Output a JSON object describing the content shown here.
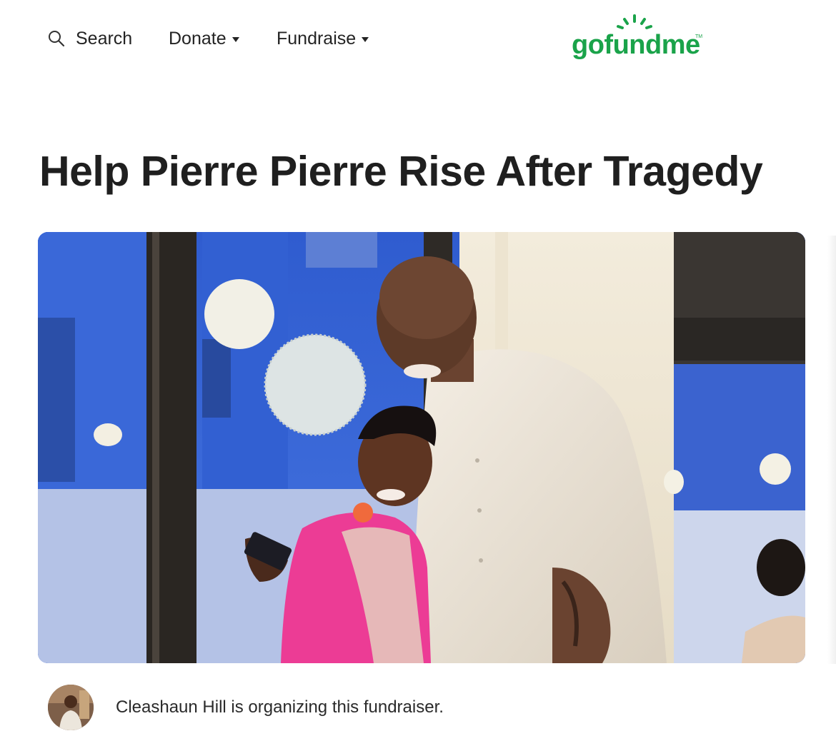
{
  "nav": {
    "search_label": "Search",
    "donate_label": "Donate",
    "fundraise_label": "Fundraise"
  },
  "brand": {
    "logo_text": "gofundme",
    "trademark": "TM",
    "color": "#1aa34a"
  },
  "campaign": {
    "title": "Help Pierre Pierre Rise After Tragedy",
    "hero_image": "photo-two-people-hugging",
    "organizer_text": "Cleashaun Hill is organizing this fundraiser."
  },
  "icons": {
    "search": "search-icon",
    "caret": "chevron-down-icon"
  }
}
